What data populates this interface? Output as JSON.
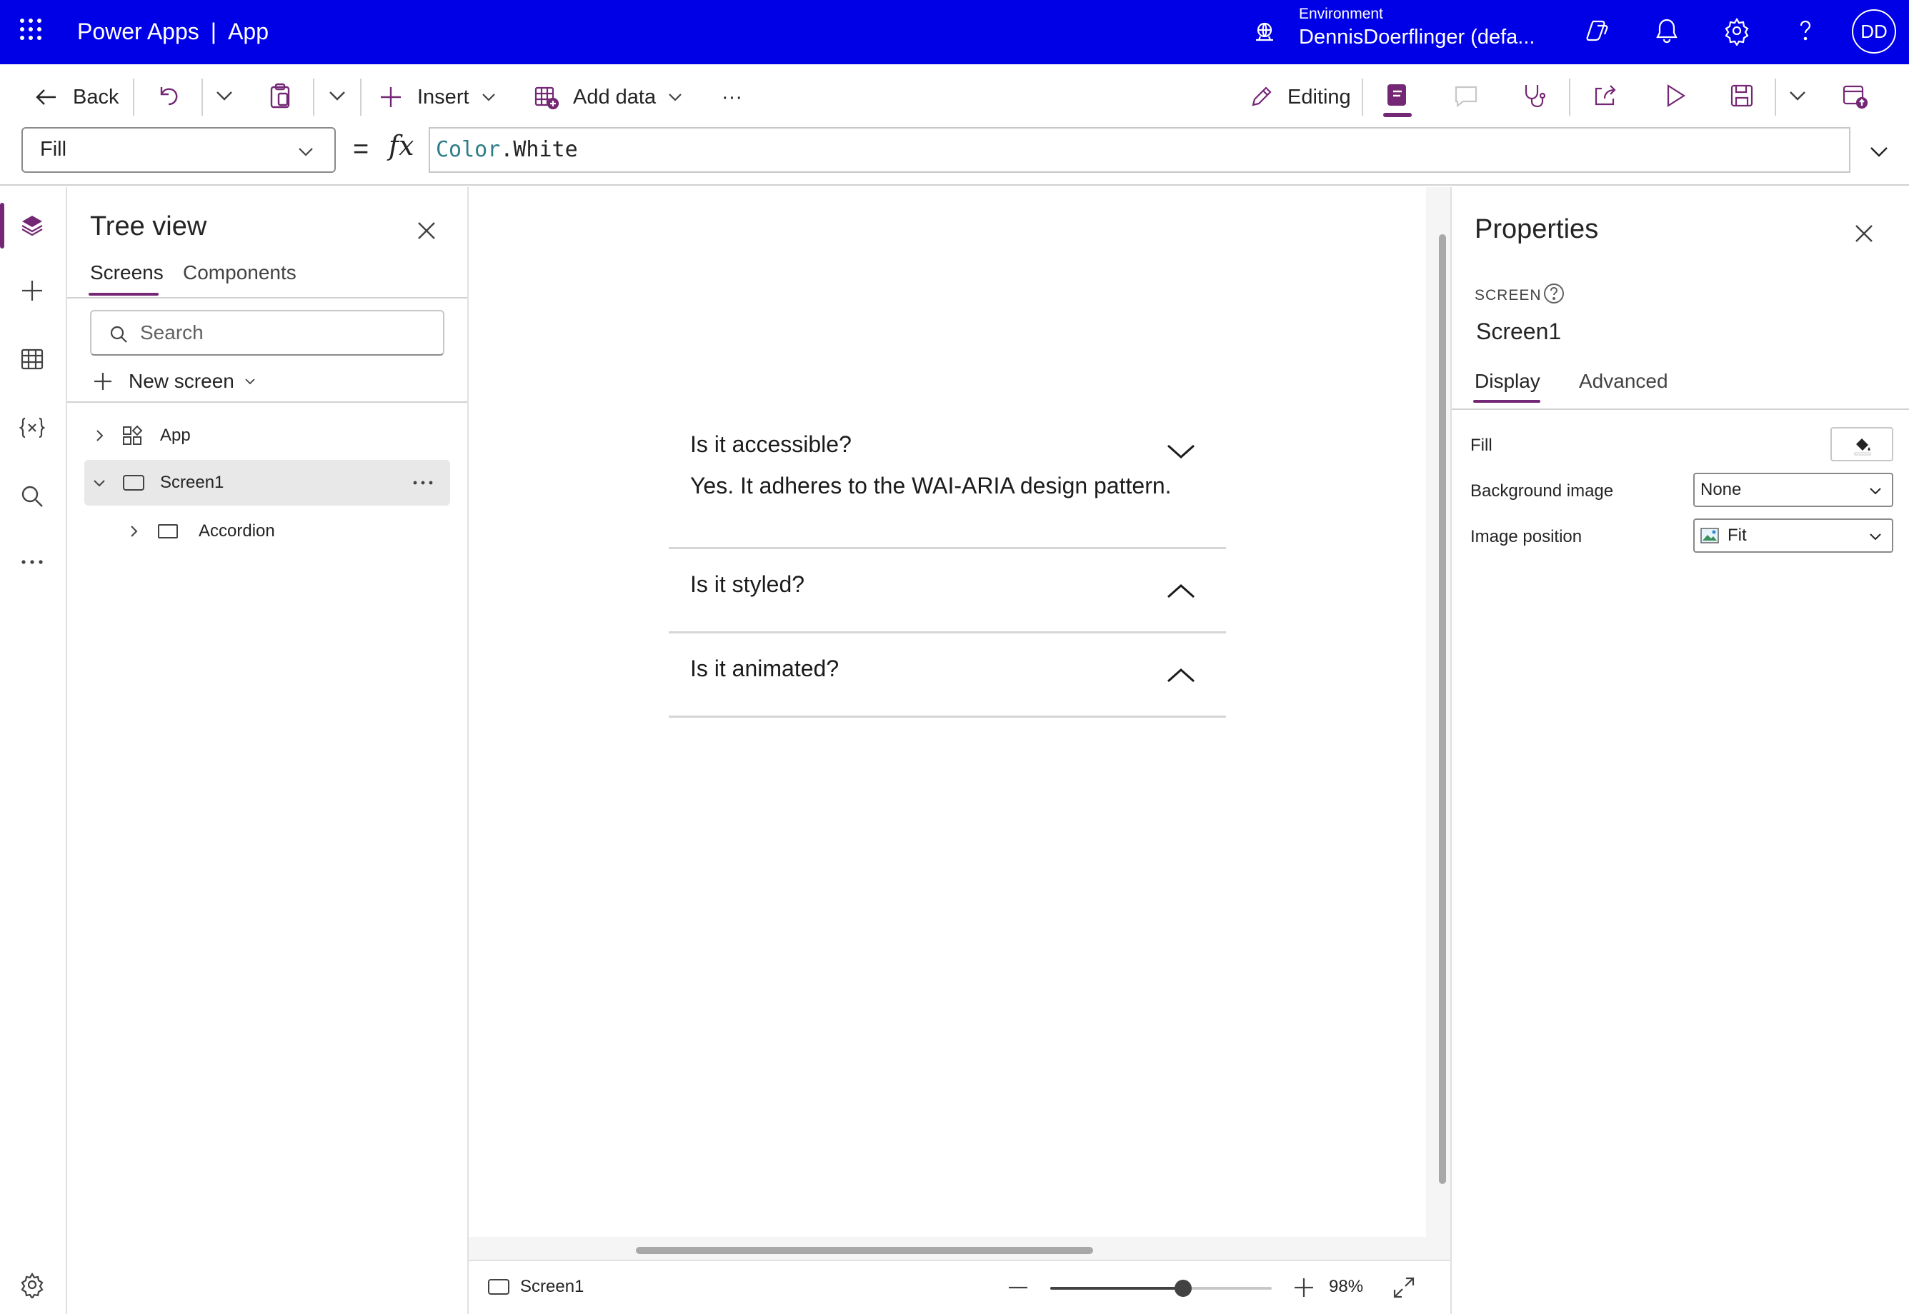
{
  "header": {
    "app_name": "Power Apps",
    "separator": "|",
    "app_context": "App",
    "environment_label": "Environment",
    "environment_name": "DennisDoerflinger (defa...",
    "avatar_initials": "DD",
    "brand_color": "#0000e6"
  },
  "toolbar": {
    "back_label": "Back",
    "insert_label": "Insert",
    "add_data_label": "Add data",
    "more_label": "···",
    "editing_label": "Editing"
  },
  "formula_bar": {
    "property": "Fill",
    "equals": "=",
    "fx": "fx",
    "formula_object": "Color",
    "formula_member": ".White"
  },
  "tree_view": {
    "title": "Tree view",
    "tabs": [
      "Screens",
      "Components"
    ],
    "search_placeholder": "Search",
    "new_screen_label": "New screen",
    "nodes": [
      {
        "label": "App"
      },
      {
        "label": "Screen1"
      },
      {
        "label": "Accordion"
      }
    ]
  },
  "canvas": {
    "accordion": [
      {
        "question": "Is it accessible?",
        "answer": "Yes. It adheres to the WAI-ARIA design pattern.",
        "expanded": true
      },
      {
        "question": "Is it styled?",
        "expanded": false
      },
      {
        "question": "Is it animated?",
        "expanded": false
      }
    ]
  },
  "status_bar": {
    "screen_name": "Screen1",
    "zoom_label": "98%",
    "zoom_fraction": 0.6
  },
  "properties": {
    "title": "Properties",
    "type_label": "SCREEN",
    "screen_name": "Screen1",
    "tabs": [
      "Display",
      "Advanced"
    ],
    "fill_label": "Fill",
    "background_image_label": "Background image",
    "background_image_value": "None",
    "image_position_label": "Image position",
    "image_position_value": "Fit"
  },
  "colors": {
    "accent": "#742774",
    "header": "#0000e6"
  }
}
